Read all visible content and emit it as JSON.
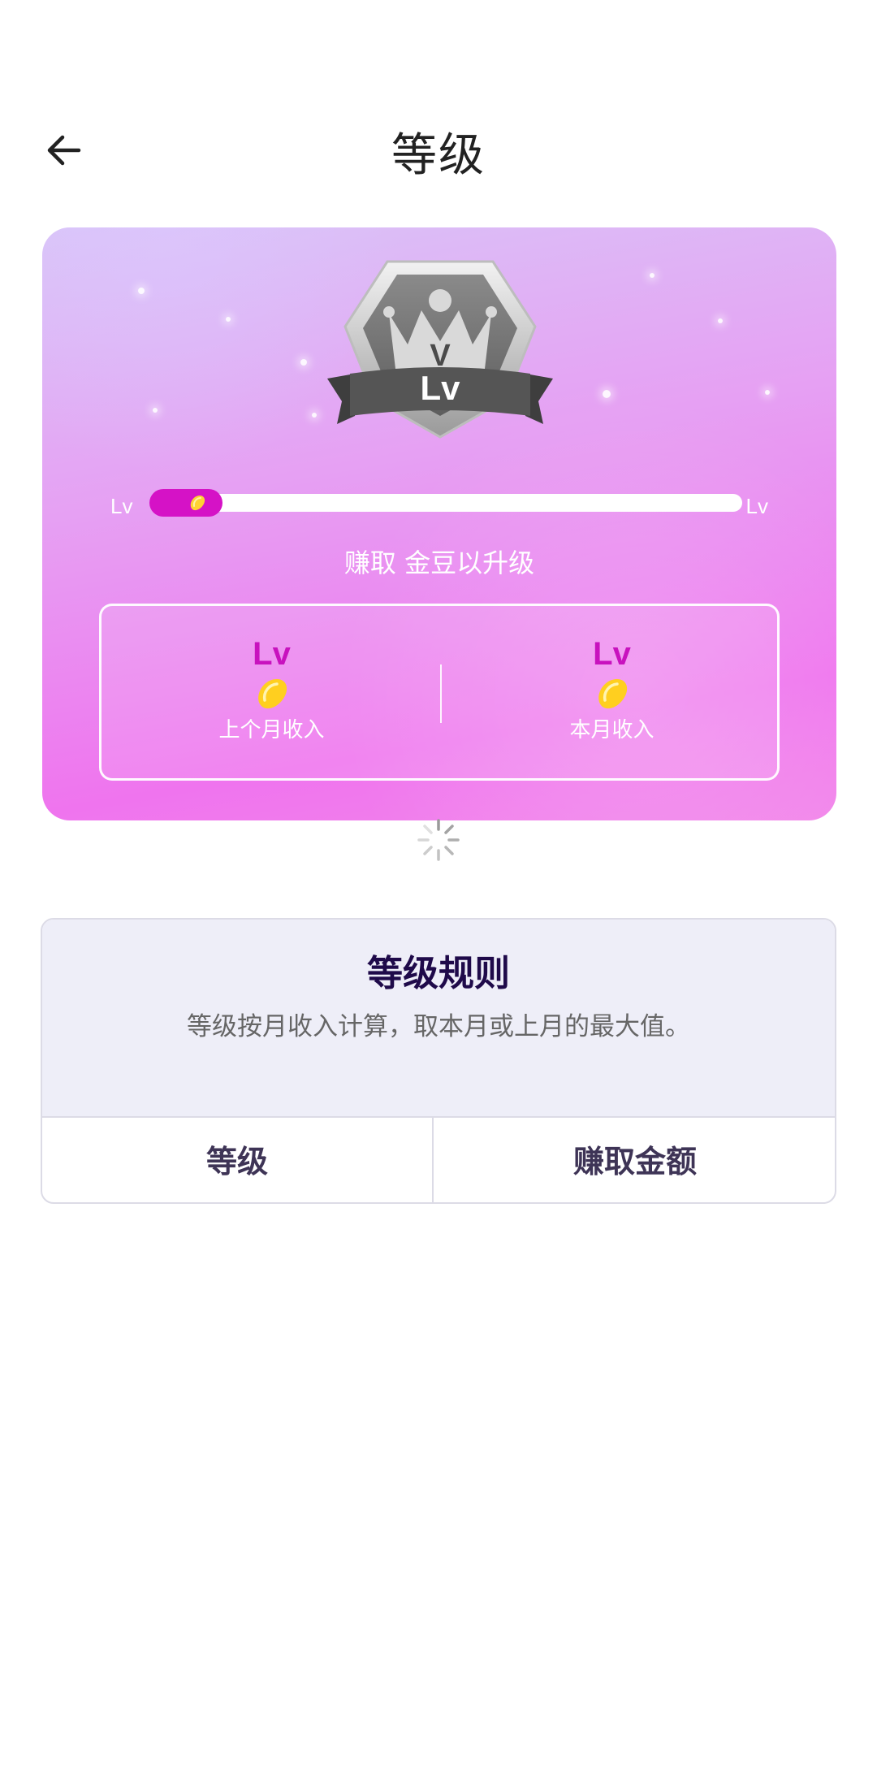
{
  "header": {
    "title": "等级"
  },
  "level_card": {
    "badge_label": "Lv",
    "badge_emblem": "V",
    "progress": {
      "current_label": "Lv",
      "next_label": "Lv",
      "fill_fraction": 0.08
    },
    "earn_text": "赚取 金豆以升级",
    "stats": {
      "last_month": {
        "level": "Lv",
        "label": "上个月收入"
      },
      "this_month": {
        "level": "Lv",
        "label": "本月收入"
      }
    }
  },
  "rules": {
    "title": "等级规则",
    "description": "等级按月收入计算，取本月或上月的最大值。",
    "columns": [
      "等级",
      "赚取金额"
    ]
  },
  "colors": {
    "accent_magenta": "#d512c6",
    "card_gradient_start": "#d9c4f7",
    "card_gradient_end": "#ef74ee",
    "rules_title": "#1f0a4a"
  },
  "icons": {
    "back": "arrow-left-icon",
    "badge": "crown-shield-badge-icon",
    "bean": "gold-bean-icon",
    "loading": "loading-spinner-icon"
  }
}
